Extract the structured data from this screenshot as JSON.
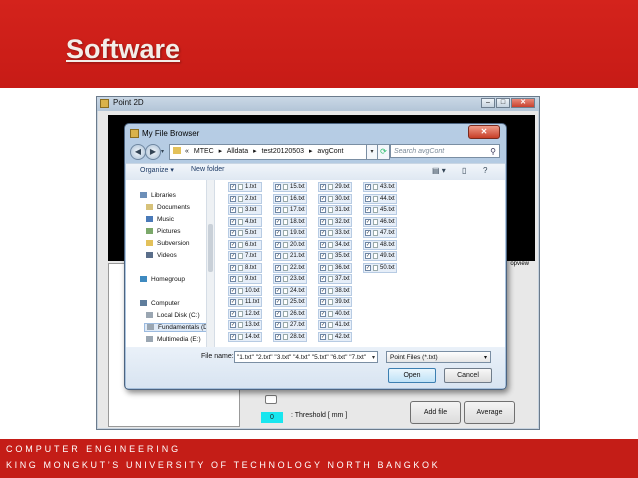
{
  "slide": {
    "title": "Software",
    "footer_line1": "COMPUTER ENGINEERING",
    "footer_line2": "KING MONGKUT’S UNIVERSITY OF TECHNOLOGY NORTH BANGKOK"
  },
  "point2d": {
    "title": "Point 2D",
    "minimize": "–",
    "maximize": "□",
    "close": "✕",
    "canvas_label": "opview",
    "threshold_value": "0",
    "threshold_label": ": Threshold [ mm ]",
    "add_file_label": "Add file",
    "average_label": "Average"
  },
  "dialog": {
    "title": "My File Browser",
    "close": "✕",
    "back": "◀",
    "forward": "▶",
    "path_prefix": "«",
    "path": [
      {
        "label": "MTEC"
      },
      {
        "label": "Alldata"
      },
      {
        "label": "test20120503"
      },
      {
        "label": "avgCont"
      }
    ],
    "path_sep": "▸",
    "search_placeholder": "Search avgCont",
    "organize": "Organize ▾",
    "new_folder": "New folder",
    "nav_items": [
      {
        "label": "Libraries",
        "icon": "library-icon",
        "color": "#6d8fb8"
      },
      {
        "label": "Documents",
        "icon": "documents-icon",
        "color": "#d7c27a"
      },
      {
        "label": "Music",
        "icon": "music-icon",
        "color": "#4a7ab8"
      },
      {
        "label": "Pictures",
        "icon": "pictures-icon",
        "color": "#7ba86a"
      },
      {
        "label": "Subversion",
        "icon": "folder-icon",
        "color": "#e3c15a"
      },
      {
        "label": "Videos",
        "icon": "videos-icon",
        "color": "#5a6e8a"
      },
      {
        "label": "Homegroup",
        "icon": "homegroup-icon",
        "color": "#3e8ac0"
      },
      {
        "label": "Computer",
        "icon": "computer-icon",
        "color": "#5f7d9c"
      },
      {
        "label": "Local Disk (C:)",
        "icon": "disk-icon",
        "color": "#9aa6b2"
      },
      {
        "label": "Fundamentals (D",
        "icon": "disk-icon",
        "color": "#9aa6b2"
      },
      {
        "label": "Multimedia (E:)",
        "icon": "disk-icon",
        "color": "#9aa6b2"
      }
    ],
    "checkmark": "✓",
    "files": [
      [
        "1.txt",
        "2.txt",
        "3.txt",
        "4.txt",
        "5.txt",
        "6.txt",
        "7.txt",
        "8.txt",
        "9.txt",
        "10.txt",
        "11.txt",
        "12.txt",
        "13.txt",
        "14.txt"
      ],
      [
        "15.txt",
        "16.txt",
        "17.txt",
        "18.txt",
        "19.txt",
        "20.txt",
        "21.txt",
        "22.txt",
        "23.txt",
        "24.txt",
        "25.txt",
        "26.txt",
        "27.txt",
        "28.txt"
      ],
      [
        "29.txt",
        "30.txt",
        "31.txt",
        "32.txt",
        "33.txt",
        "34.txt",
        "35.txt",
        "36.txt",
        "37.txt",
        "38.txt",
        "39.txt",
        "40.txt",
        "41.txt",
        "42.txt"
      ],
      [
        "43.txt",
        "44.txt",
        "45.txt",
        "46.txt",
        "47.txt",
        "48.txt",
        "49.txt",
        "50.txt"
      ]
    ],
    "filename_label": "File name:",
    "filename_value": "\"1.txt\" \"2.txt\" \"3.txt\" \"4.txt\" \"5.txt\" \"6.txt\" \"7.txt\"",
    "filetype": "Point Files (*.txt)",
    "open_label": "Open",
    "cancel_label": "Cancel"
  }
}
